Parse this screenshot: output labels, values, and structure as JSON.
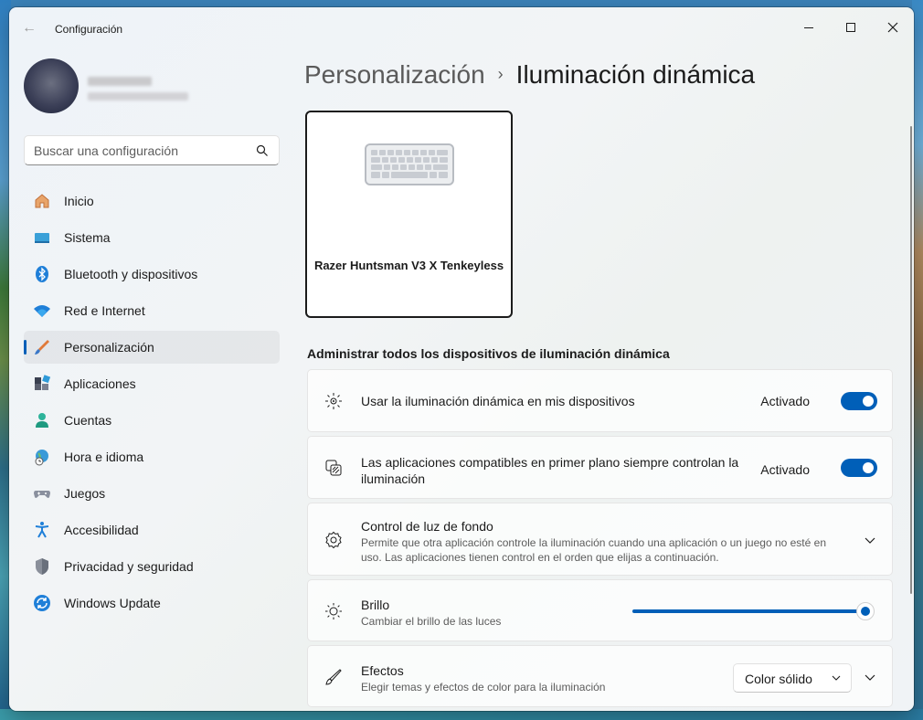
{
  "app": {
    "title": "Configuración"
  },
  "search": {
    "placeholder": "Buscar una configuración"
  },
  "sidebar": {
    "items": [
      {
        "label": "Inicio",
        "icon": "home-icon"
      },
      {
        "label": "Sistema",
        "icon": "system-icon"
      },
      {
        "label": "Bluetooth y dispositivos",
        "icon": "bluetooth-icon"
      },
      {
        "label": "Red e Internet",
        "icon": "wifi-icon"
      },
      {
        "label": "Personalización",
        "icon": "brush-icon",
        "active": true
      },
      {
        "label": "Aplicaciones",
        "icon": "apps-icon"
      },
      {
        "label": "Cuentas",
        "icon": "person-icon"
      },
      {
        "label": "Hora e idioma",
        "icon": "globe-clock-icon"
      },
      {
        "label": "Juegos",
        "icon": "gamepad-icon"
      },
      {
        "label": "Accesibilidad",
        "icon": "accessibility-icon"
      },
      {
        "label": "Privacidad y seguridad",
        "icon": "shield-icon"
      },
      {
        "label": "Windows Update",
        "icon": "update-icon"
      }
    ]
  },
  "breadcrumb": {
    "parent": "Personalización",
    "separator": "›",
    "current": "Iluminación dinámica"
  },
  "device": {
    "name": "Razer Huntsman V3 X Tenkeyless",
    "icon": "keyboard-icon"
  },
  "section": {
    "title": "Administrar todos los dispositivos de iluminación dinámica"
  },
  "settings": {
    "use_lighting": {
      "title": "Usar la iluminación dinámica en mis dispositivos",
      "state": "Activado",
      "on": true
    },
    "foreground_apps": {
      "title_line1": "Las aplicaciones compatibles en primer plano siempre controlan la",
      "title_line2": "iluminación",
      "state": "Activado",
      "on": true
    },
    "background_control": {
      "title": "Control de luz de fondo",
      "sub_line1": "Permite que otra aplicación controle la iluminación cuando una aplicación o un juego no esté en",
      "sub_line2": "uso. Las aplicaciones tienen control en el orden que elijas a continuación."
    },
    "brightness": {
      "title": "Brillo",
      "sub": "Cambiar el brillo de las luces",
      "value_fraction": 1.0
    },
    "effects": {
      "title": "Efectos",
      "sub": "Elegir temas y efectos de color para la iluminación",
      "selected": "Color sólido"
    }
  },
  "colors": {
    "accent": "#005fb8"
  }
}
